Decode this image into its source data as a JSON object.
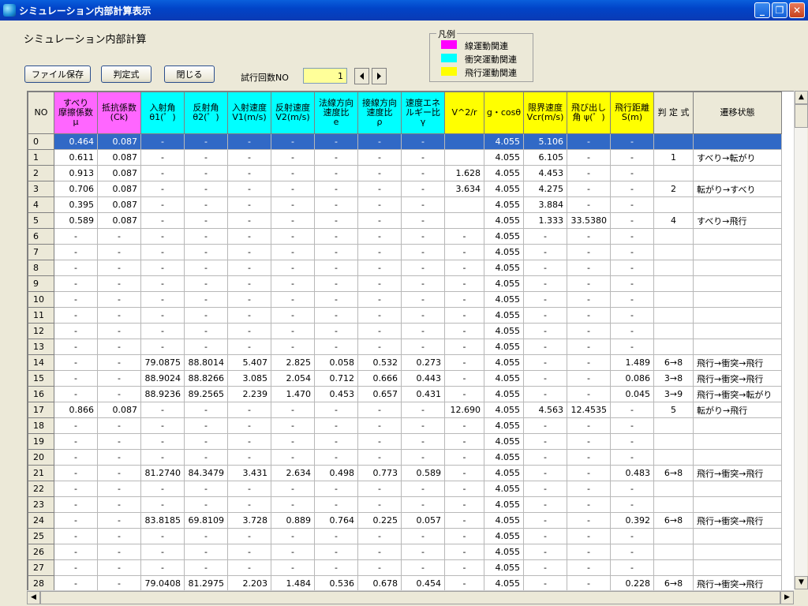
{
  "window": {
    "title": "シミュレーション内部計算表示"
  },
  "heading": "シミュレーション内部計算",
  "toolbar": {
    "save_label": "ファイル保存",
    "judge_label": "判定式",
    "close_label": "閉じる"
  },
  "trial": {
    "label": "試行回数NO",
    "value": "1"
  },
  "legend": {
    "title": "凡例",
    "items": [
      {
        "label": "線運動関連",
        "color": "#ff00ff"
      },
      {
        "label": "衝突運動関連",
        "color": "#00ffff"
      },
      {
        "label": "飛行運動関連",
        "color": "#ffff00"
      }
    ]
  },
  "table": {
    "headers": [
      {
        "lines": [
          "NO"
        ],
        "color": "#ece9d8"
      },
      {
        "lines": [
          "すべり",
          "摩擦係数",
          "μ"
        ],
        "color": "#ff66ff"
      },
      {
        "lines": [
          "抵抗係数",
          "(Ck)"
        ],
        "color": "#ff66ff"
      },
      {
        "lines": [
          "入射角",
          "θ1(゜)"
        ],
        "color": "#00ffff"
      },
      {
        "lines": [
          "反射角",
          "θ2(゜)"
        ],
        "color": "#00ffff"
      },
      {
        "lines": [
          "入射速度",
          "V1(m/s)"
        ],
        "color": "#00ffff"
      },
      {
        "lines": [
          "反射速度",
          "V2(m/s)"
        ],
        "color": "#00ffff"
      },
      {
        "lines": [
          "法線方向",
          "速度比",
          "e"
        ],
        "color": "#00ffff"
      },
      {
        "lines": [
          "接線方向",
          "速度比",
          "ρ"
        ],
        "color": "#00ffff"
      },
      {
        "lines": [
          "速度エネ",
          "ルギー比",
          "γ"
        ],
        "color": "#00ffff"
      },
      {
        "lines": [
          "V^2/r"
        ],
        "color": "#ffff00"
      },
      {
        "lines": [
          "g・cosθ"
        ],
        "color": "#ffff00"
      },
      {
        "lines": [
          "限界速度",
          "Vcr(m/s)"
        ],
        "color": "#ffff00"
      },
      {
        "lines": [
          "飛び出し",
          "角 ψ(゜)"
        ],
        "color": "#ffff00"
      },
      {
        "lines": [
          "飛行距離",
          "S(m)"
        ],
        "color": "#ffff00"
      },
      {
        "lines": [
          "判 定 式"
        ],
        "color": "#ece9d8"
      },
      {
        "lines": [
          "遷移状態"
        ],
        "color": "#ece9d8"
      }
    ],
    "rows": [
      [
        "0",
        "0.464",
        "0.087",
        "-",
        "-",
        "-",
        "-",
        "-",
        "-",
        "-",
        "",
        "4.055",
        "5.106",
        "-",
        "-",
        "",
        ""
      ],
      [
        "1",
        "0.611",
        "0.087",
        "-",
        "-",
        "-",
        "-",
        "-",
        "-",
        "-",
        "",
        "4.055",
        "6.105",
        "-",
        "-",
        "1",
        "すべり→転がり"
      ],
      [
        "2",
        "0.913",
        "0.087",
        "-",
        "-",
        "-",
        "-",
        "-",
        "-",
        "-",
        "1.628",
        "4.055",
        "4.453",
        "-",
        "-",
        "",
        ""
      ],
      [
        "3",
        "0.706",
        "0.087",
        "-",
        "-",
        "-",
        "-",
        "-",
        "-",
        "-",
        "3.634",
        "4.055",
        "4.275",
        "-",
        "-",
        "2",
        "転がり→すべり"
      ],
      [
        "4",
        "0.395",
        "0.087",
        "-",
        "-",
        "-",
        "-",
        "-",
        "-",
        "-",
        "",
        "4.055",
        "3.884",
        "-",
        "-",
        "",
        ""
      ],
      [
        "5",
        "0.589",
        "0.087",
        "-",
        "-",
        "-",
        "-",
        "-",
        "-",
        "-",
        "",
        "4.055",
        "1.333",
        "33.5380",
        "-",
        "4",
        "すべり→飛行"
      ],
      [
        "6",
        "-",
        "-",
        "-",
        "-",
        "-",
        "-",
        "-",
        "-",
        "-",
        "-",
        "4.055",
        "-",
        "-",
        "-",
        "",
        ""
      ],
      [
        "7",
        "-",
        "-",
        "-",
        "-",
        "-",
        "-",
        "-",
        "-",
        "-",
        "-",
        "4.055",
        "-",
        "-",
        "-",
        "",
        ""
      ],
      [
        "8",
        "-",
        "-",
        "-",
        "-",
        "-",
        "-",
        "-",
        "-",
        "-",
        "-",
        "4.055",
        "-",
        "-",
        "-",
        "",
        ""
      ],
      [
        "9",
        "-",
        "-",
        "-",
        "-",
        "-",
        "-",
        "-",
        "-",
        "-",
        "-",
        "4.055",
        "-",
        "-",
        "-",
        "",
        ""
      ],
      [
        "10",
        "-",
        "-",
        "-",
        "-",
        "-",
        "-",
        "-",
        "-",
        "-",
        "-",
        "4.055",
        "-",
        "-",
        "-",
        "",
        ""
      ],
      [
        "11",
        "-",
        "-",
        "-",
        "-",
        "-",
        "-",
        "-",
        "-",
        "-",
        "-",
        "4.055",
        "-",
        "-",
        "-",
        "",
        ""
      ],
      [
        "12",
        "-",
        "-",
        "-",
        "-",
        "-",
        "-",
        "-",
        "-",
        "-",
        "-",
        "4.055",
        "-",
        "-",
        "-",
        "",
        ""
      ],
      [
        "13",
        "-",
        "-",
        "-",
        "-",
        "-",
        "-",
        "-",
        "-",
        "-",
        "-",
        "4.055",
        "-",
        "-",
        "-",
        "",
        ""
      ],
      [
        "14",
        "-",
        "-",
        "79.0875",
        "88.8014",
        "5.407",
        "2.825",
        "0.058",
        "0.532",
        "0.273",
        "-",
        "4.055",
        "-",
        "-",
        "1.489",
        "6→8",
        "飛行→衝突→飛行"
      ],
      [
        "15",
        "-",
        "-",
        "88.9024",
        "88.8266",
        "3.085",
        "2.054",
        "0.712",
        "0.666",
        "0.443",
        "-",
        "4.055",
        "-",
        "-",
        "0.086",
        "3→8",
        "飛行→衝突→飛行"
      ],
      [
        "16",
        "-",
        "-",
        "88.9236",
        "89.2565",
        "2.239",
        "1.470",
        "0.453",
        "0.657",
        "0.431",
        "-",
        "4.055",
        "-",
        "-",
        "0.045",
        "3→9",
        "飛行→衝突→転がり"
      ],
      [
        "17",
        "0.866",
        "0.087",
        "-",
        "-",
        "-",
        "-",
        "-",
        "-",
        "-",
        "12.690",
        "4.055",
        "4.563",
        "12.4535",
        "-",
        "5",
        "転がり→飛行"
      ],
      [
        "18",
        "-",
        "-",
        "-",
        "-",
        "-",
        "-",
        "-",
        "-",
        "-",
        "-",
        "4.055",
        "-",
        "-",
        "-",
        "",
        ""
      ],
      [
        "19",
        "-",
        "-",
        "-",
        "-",
        "-",
        "-",
        "-",
        "-",
        "-",
        "-",
        "4.055",
        "-",
        "-",
        "-",
        "",
        ""
      ],
      [
        "20",
        "-",
        "-",
        "-",
        "-",
        "-",
        "-",
        "-",
        "-",
        "-",
        "-",
        "4.055",
        "-",
        "-",
        "-",
        "",
        ""
      ],
      [
        "21",
        "-",
        "-",
        "81.2740",
        "84.3479",
        "3.431",
        "2.634",
        "0.498",
        "0.773",
        "0.589",
        "-",
        "4.055",
        "-",
        "-",
        "0.483",
        "6→8",
        "飛行→衝突→飛行"
      ],
      [
        "22",
        "-",
        "-",
        "-",
        "-",
        "-",
        "-",
        "-",
        "-",
        "-",
        "-",
        "4.055",
        "-",
        "-",
        "-",
        "",
        ""
      ],
      [
        "23",
        "-",
        "-",
        "-",
        "-",
        "-",
        "-",
        "-",
        "-",
        "-",
        "-",
        "4.055",
        "-",
        "-",
        "-",
        "",
        ""
      ],
      [
        "24",
        "-",
        "-",
        "83.8185",
        "69.8109",
        "3.728",
        "0.889",
        "0.764",
        "0.225",
        "0.057",
        "-",
        "4.055",
        "-",
        "-",
        "0.392",
        "6→8",
        "飛行→衝突→飛行"
      ],
      [
        "25",
        "-",
        "-",
        "-",
        "-",
        "-",
        "-",
        "-",
        "-",
        "-",
        "-",
        "4.055",
        "-",
        "-",
        "-",
        "",
        ""
      ],
      [
        "26",
        "-",
        "-",
        "-",
        "-",
        "-",
        "-",
        "-",
        "-",
        "-",
        "-",
        "4.055",
        "-",
        "-",
        "-",
        "",
        ""
      ],
      [
        "27",
        "-",
        "-",
        "-",
        "-",
        "-",
        "-",
        "-",
        "-",
        "-",
        "-",
        "4.055",
        "-",
        "-",
        "-",
        "",
        ""
      ],
      [
        "28",
        "-",
        "-",
        "79.0408",
        "81.2975",
        "2.203",
        "1.484",
        "0.536",
        "0.678",
        "0.454",
        "-",
        "4.055",
        "-",
        "-",
        "0.228",
        "6→8",
        "飛行→衝突→飛行"
      ]
    ]
  }
}
